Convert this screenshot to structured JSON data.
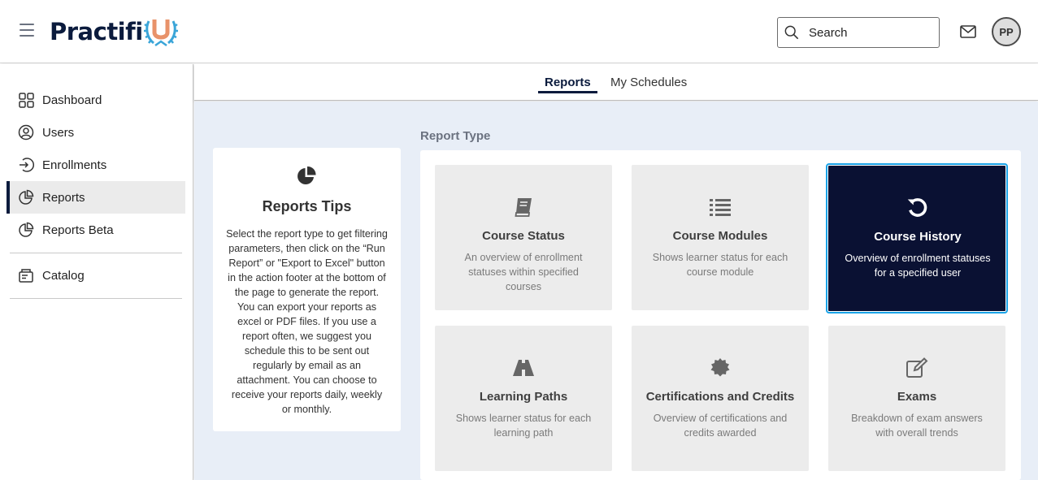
{
  "header": {
    "logo_text": "Practifi",
    "search_placeholder": "Search",
    "avatar_initials": "PP"
  },
  "sidebar": {
    "items": [
      {
        "label": "Dashboard",
        "icon": "grid-icon"
      },
      {
        "label": "Users",
        "icon": "user-circle-icon"
      },
      {
        "label": "Enrollments",
        "icon": "sign-in-icon"
      },
      {
        "label": "Reports",
        "icon": "pie-chart-icon",
        "active": true
      },
      {
        "label": "Reports Beta",
        "icon": "pie-chart-icon"
      },
      {
        "label": "Catalog",
        "icon": "catalog-icon"
      }
    ]
  },
  "tabs": [
    {
      "label": "Reports",
      "active": true
    },
    {
      "label": "My Schedules",
      "active": false
    }
  ],
  "tips": {
    "title": "Reports Tips",
    "body": "Select the report type to get filtering parameters, then click on the “Run Report” or \"Export to Excel\" button in the action footer at the bottom of the page to generate the report. You can export your reports as excel or PDF files. If you use a report often, we suggest you schedule this to be sent out regularly by email as an attachment. You can choose to receive your reports daily, weekly or monthly."
  },
  "report_type_label": "Report Type",
  "report_cards": [
    {
      "title": "Course Status",
      "desc": "An overview of enrollment statuses within specified courses",
      "icon": "book-icon"
    },
    {
      "title": "Course Modules",
      "desc": "Shows learner status for each course module",
      "icon": "list-icon"
    },
    {
      "title": "Course History",
      "desc": "Overview of enrollment statuses for a specified user",
      "icon": "history-icon",
      "selected": true
    },
    {
      "title": "Learning Paths",
      "desc": "Shows learner status for each learning path",
      "icon": "road-icon"
    },
    {
      "title": "Certifications and Credits",
      "desc": "Overview of certifications and credits awarded",
      "icon": "certificate-icon"
    },
    {
      "title": "Exams",
      "desc": "Breakdown of exam answers with overall trends",
      "icon": "edit-icon"
    }
  ],
  "colors": {
    "brand_navy": "#0b1b3d",
    "selected_card": "#0a1133",
    "selected_outline": "#1aa3e8",
    "logo_accent": "#e8926a",
    "logo_wreath": "#3aa5d8"
  }
}
